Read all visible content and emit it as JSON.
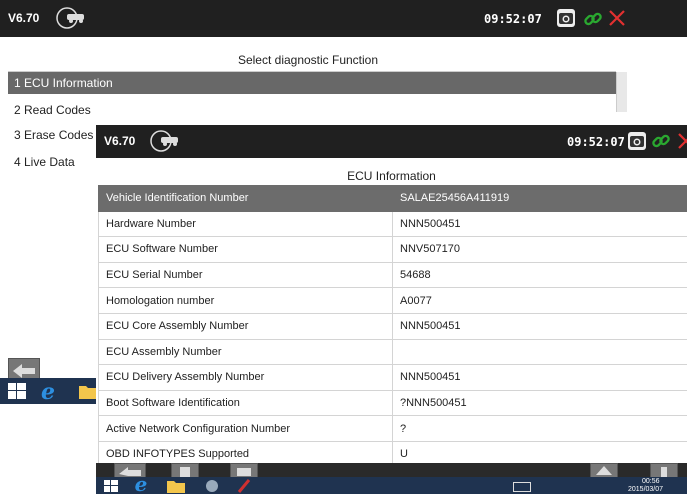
{
  "app": {
    "version": "V6.70",
    "time": "09:52:07"
  },
  "menu": {
    "title": "Select diagnostic Function",
    "items": [
      {
        "label": "1  ECU Information"
      },
      {
        "label": "2  Read Codes"
      },
      {
        "label": "3  Erase Codes"
      },
      {
        "label": "4  Live Data"
      }
    ]
  },
  "ecu": {
    "title": "ECU Information",
    "rows": [
      {
        "name": "Vehicle Identification Number",
        "value": "SALAE25456A411919"
      },
      {
        "name": "Hardware Number",
        "value": "NNN500451"
      },
      {
        "name": "ECU Software Number",
        "value": "NNV507170"
      },
      {
        "name": "ECU Serial Number",
        "value": "54688"
      },
      {
        "name": "Homologation number",
        "value": "A0077"
      },
      {
        "name": "ECU Core Assembly Number",
        "value": "NNN500451"
      },
      {
        "name": "ECU Assembly Number",
        "value": ""
      },
      {
        "name": "ECU Delivery Assembly Number",
        "value": "NNN500451"
      },
      {
        "name": "Boot Software Identification",
        "value": "?NNN500451"
      },
      {
        "name": "Active Network Configuration Number",
        "value": "?"
      },
      {
        "name": "OBD INFOTYPES Supported",
        "value": "U"
      }
    ]
  },
  "tray": {
    "time": "00:56",
    "date": "2015/03/07"
  },
  "colors": {
    "close": "#e23030",
    "link": "#2aa830",
    "camera": "#f2f2f2",
    "selected_row": "#6c6c6c",
    "topbar": "#202020"
  },
  "icons": [
    "vin-car-icon",
    "camera-icon",
    "link-icon",
    "close-icon",
    "back-arrow-icon",
    "windows-logo-icon",
    "ie-icon",
    "folder-icon",
    "up-arrow-icon",
    "keyboard-icon"
  ]
}
